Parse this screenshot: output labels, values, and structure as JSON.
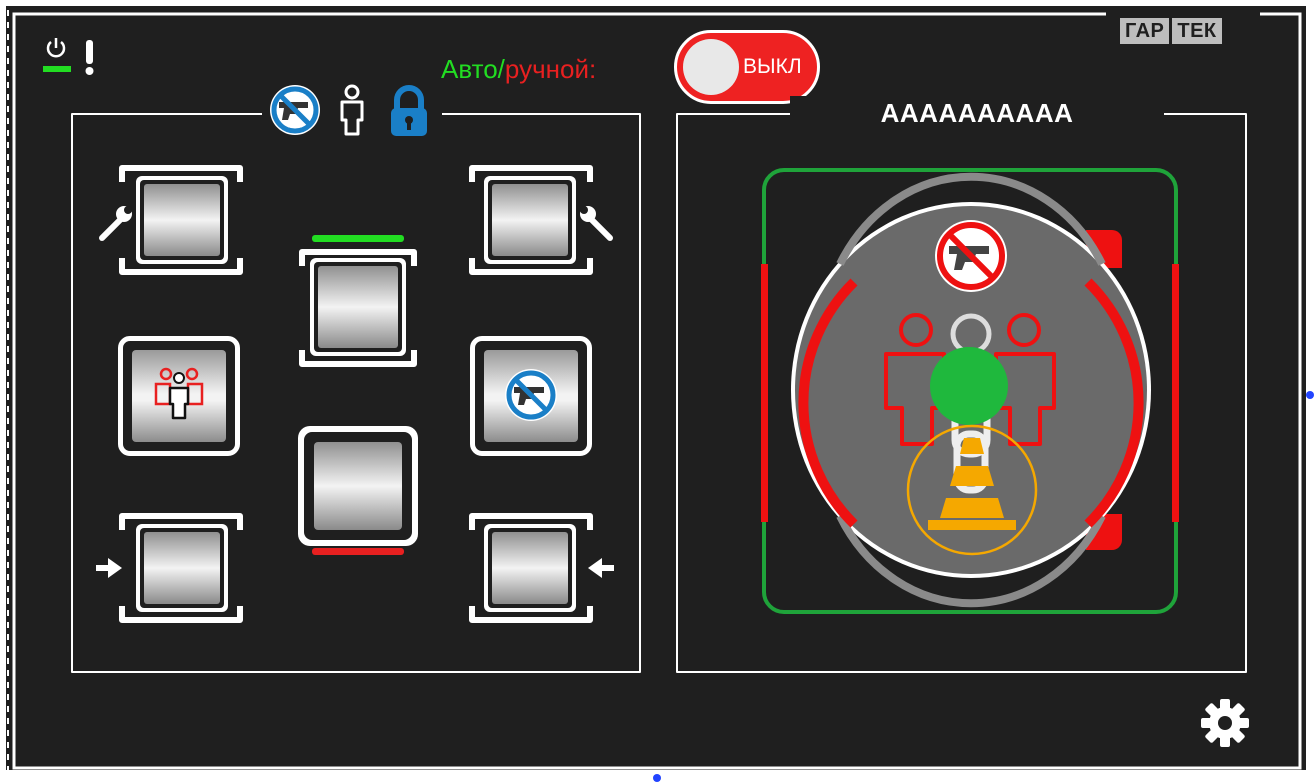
{
  "header": {
    "brand_left": "ГАР",
    "brand_right": "ТЕК",
    "mode_auto": "Авто",
    "mode_sep": "/",
    "mode_manual": "ручной:",
    "toggle_label": "ВЫКЛ"
  },
  "right_panel": {
    "title": "AAAAAAAAAA"
  },
  "colors": {
    "background": "#1f1f1f",
    "accent_green": "#22dd22",
    "accent_red": "#e82020",
    "accent_blue": "#1a7fc7",
    "accent_orange": "#f5a800"
  },
  "icons": {
    "status": [
      "power-icon",
      "alert-icon"
    ],
    "panel_header": [
      "no-weapon-icon",
      "person-icon",
      "lock-icon"
    ],
    "settings": "gear-icon"
  }
}
